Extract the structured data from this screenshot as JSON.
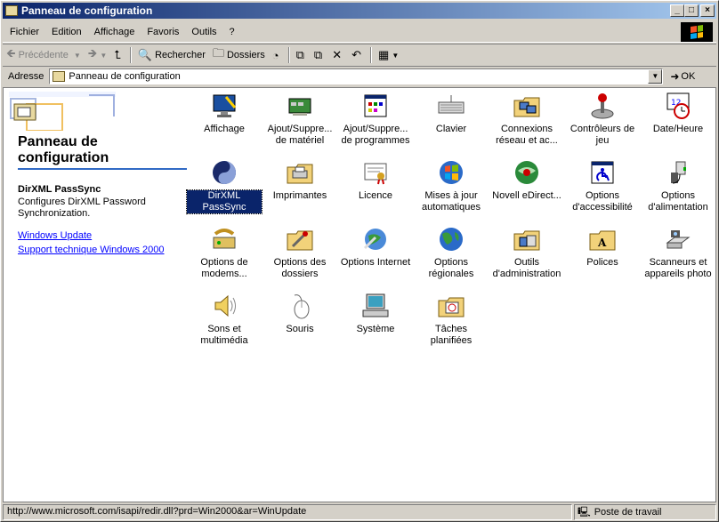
{
  "window": {
    "title": "Panneau de configuration"
  },
  "menu": [
    "Fichier",
    "Edition",
    "Affichage",
    "Favoris",
    "Outils",
    "?"
  ],
  "toolbar": {
    "back": "Précédente",
    "search": "Rechercher",
    "folders": "Dossiers"
  },
  "address": {
    "label": "Adresse",
    "value": "Panneau de configuration",
    "go": "OK"
  },
  "left_panel": {
    "title": "Panneau de configuration",
    "selected_name": "DirXML PassSync",
    "selected_desc": "Configures DirXML Password Synchronization.",
    "links": [
      "Windows Update",
      "Support technique Windows 2000"
    ]
  },
  "items": [
    {
      "label": "Affichage",
      "icon": "display-icon"
    },
    {
      "label": "Ajout/Suppre... de matériel",
      "icon": "add-hardware-icon"
    },
    {
      "label": "Ajout/Suppre... de programmes",
      "icon": "add-programs-icon"
    },
    {
      "label": "Clavier",
      "icon": "keyboard-icon"
    },
    {
      "label": "Connexions réseau et ac...",
      "icon": "network-icon"
    },
    {
      "label": "Contrôleurs de jeu",
      "icon": "joystick-icon"
    },
    {
      "label": "Date/Heure",
      "icon": "clock-icon"
    },
    {
      "label": "DirXML PassSync",
      "icon": "yinyang-icon"
    },
    {
      "label": "Imprimantes",
      "icon": "printer-icon"
    },
    {
      "label": "Licence",
      "icon": "license-icon"
    },
    {
      "label": "Mises à jour automatiques",
      "icon": "windows-update-icon"
    },
    {
      "label": "Novell eDirect...",
      "icon": "novell-icon"
    },
    {
      "label": "Options d'accessibilité",
      "icon": "accessibility-icon"
    },
    {
      "label": "Options d'alimentation",
      "icon": "power-icon"
    },
    {
      "label": "Options de modems...",
      "icon": "modem-icon"
    },
    {
      "label": "Options des dossiers",
      "icon": "folder-options-icon"
    },
    {
      "label": "Options Internet",
      "icon": "internet-icon"
    },
    {
      "label": "Options régionales",
      "icon": "globe-icon"
    },
    {
      "label": "Outils d'administration",
      "icon": "admin-tools-icon"
    },
    {
      "label": "Polices",
      "icon": "fonts-icon"
    },
    {
      "label": "Scanneurs et appareils photo",
      "icon": "scanner-icon"
    },
    {
      "label": "Sons et multimédia",
      "icon": "speaker-icon"
    },
    {
      "label": "Souris",
      "icon": "mouse-icon"
    },
    {
      "label": "Système",
      "icon": "computer-icon"
    },
    {
      "label": "Tâches planifiées",
      "icon": "scheduled-tasks-icon"
    }
  ],
  "selected_index": 7,
  "status": {
    "text": "http://www.microsoft.com/isapi/redir.dll?prd=Win2000&ar=WinUpdate",
    "zone": "Poste de travail"
  }
}
